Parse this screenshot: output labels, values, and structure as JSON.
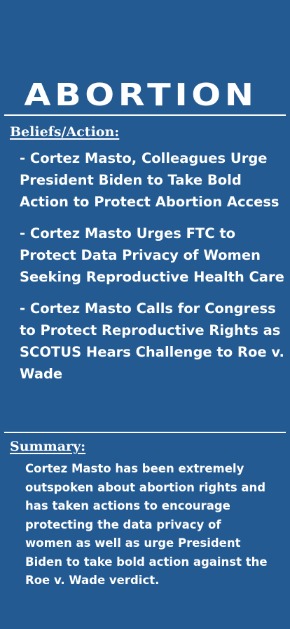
{
  "title": "ABORTION",
  "beliefs": {
    "label": "Beliefs/Action:",
    "items": [
      "- Cortez Masto, Colleagues Urge President Biden to Take Bold Action to Protect Abortion Access",
      "- Cortez Masto Urges FTC to Protect Data Privacy of Women Seeking Reproductive Health Care",
      "- Cortez Masto Calls for Congress to Protect Reproductive Rights as SCOTUS Hears Challenge to Roe v. Wade"
    ]
  },
  "summary": {
    "label": "Summary:",
    "text": "Cortez Masto has been extremely outspoken about abortion rights and has taken actions to encourage protecting the data privacy of women as well as urge President Biden to take bold action against the Roe v. Wade verdict."
  },
  "colors": {
    "background": "#235a91",
    "text": "#ffffff"
  }
}
